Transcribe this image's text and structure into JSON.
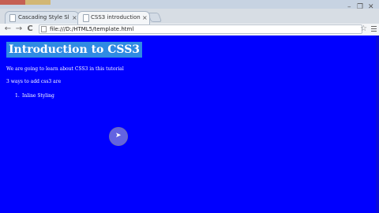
{
  "window": {
    "minimize": "–",
    "restore": "❐",
    "close": "✕"
  },
  "tabs": [
    {
      "title": "Cascading Style Sheets (C",
      "close": "×",
      "active": false
    },
    {
      "title": "CSS3 introduction",
      "close": "×",
      "active": true
    }
  ],
  "toolbar": {
    "back": "←",
    "forward": "→",
    "reload": "C",
    "url": "file:///D:/HTML5/template.html",
    "star": "☆"
  },
  "page": {
    "heading": "Introduction to CSS3",
    "intro": "We are going to learn about CSS3 in this tutorial",
    "ways": "3 ways to add css3 are",
    "list": [
      {
        "num": "1.",
        "text": "Inline Styling"
      }
    ]
  },
  "colors": {
    "page_bg": "#0000ff",
    "heading_bg": "#2f8be3",
    "text": "#ffffff"
  }
}
